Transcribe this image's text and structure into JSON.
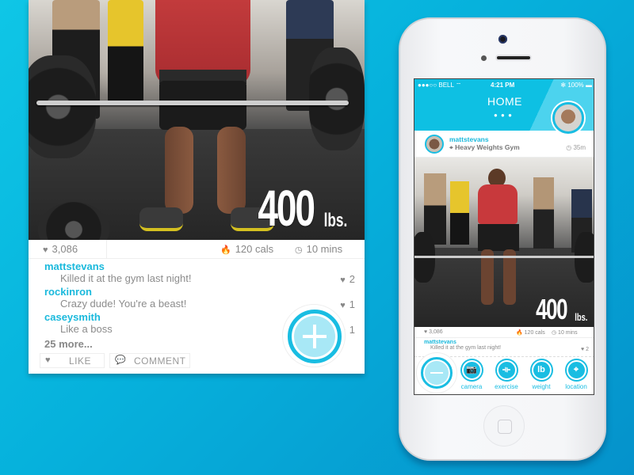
{
  "colors": {
    "accent": "#19bde2",
    "background": "#06b1dc",
    "text_gray": "#888888"
  },
  "feed_card": {
    "weight_value": "400",
    "weight_unit": "lbs.",
    "stats": {
      "likes": "3,086",
      "calories": "120 cals",
      "duration": "10 mins"
    },
    "comments": [
      {
        "user": "mattstevans",
        "text": "Killed it at the gym last night!",
        "likes": "2"
      },
      {
        "user": "rockinron",
        "text": "Crazy dude! You're a beast!",
        "likes": "1"
      },
      {
        "user": "caseysmith",
        "text": "Like a boss",
        "likes": "1"
      }
    ],
    "more_comments": "25 more...",
    "actions": {
      "like": "LIKE",
      "comment": "COMMENT"
    },
    "icons": {
      "heart": "♥",
      "flame": "🔥",
      "clock": "◷",
      "speech": "💬",
      "plus": "+"
    }
  },
  "phone": {
    "status": {
      "carrier": "●●●○○ BELL ⌔",
      "time": "4:21 PM",
      "battery": "✻ 100% ▬"
    },
    "header": {
      "title": "HOME",
      "page_dots": "● ● ●"
    },
    "post": {
      "user": "mattstevans",
      "location": "⌖ Heavy Weights Gym",
      "age": "◷ 35m",
      "weight_value": "400",
      "weight_unit": "lbs.",
      "stats": {
        "likes": "♥ 3,086",
        "calories": "🔥 120 cals",
        "duration": "◷ 10 mins"
      },
      "comment": {
        "user": "mattstevans",
        "text": "Killed it at the gym last night!",
        "likes": "♥ 2"
      }
    },
    "tabbar": [
      {
        "label": "camera",
        "icon": "📷"
      },
      {
        "label": "exercise",
        "icon": "⟛"
      },
      {
        "label": "weight",
        "icon": "lb"
      },
      {
        "label": "location",
        "icon": "⌖"
      }
    ]
  }
}
